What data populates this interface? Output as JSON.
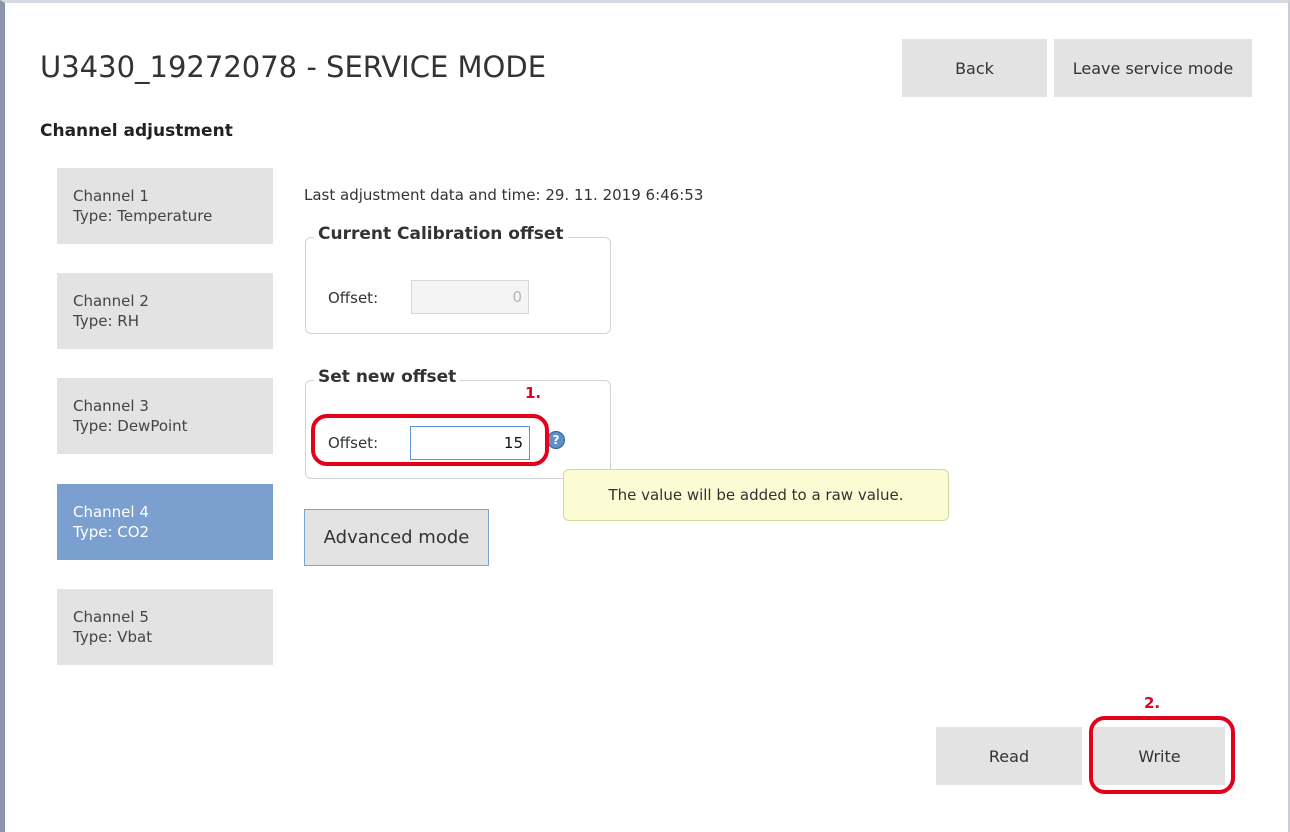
{
  "header": {
    "title": "U3430_19272078 - SERVICE MODE",
    "back_label": "Back",
    "leave_label": "Leave service mode"
  },
  "section_title": "Channel adjustment",
  "channels": [
    {
      "name": "Channel 1",
      "type": "Type: Temperature"
    },
    {
      "name": "Channel 2",
      "type": "Type: RH"
    },
    {
      "name": "Channel 3",
      "type": "Type: DewPoint"
    },
    {
      "name": "Channel 4",
      "type": "Type: CO2"
    },
    {
      "name": "Channel 5",
      "type": "Type: Vbat"
    }
  ],
  "selected_channel_index": 3,
  "last_adjustment": "Last adjustment data and time:  29. 11. 2019 6:46:53",
  "current_offset": {
    "legend": "Current Calibration offset",
    "label": "Offset:",
    "value": "0"
  },
  "new_offset": {
    "legend": "Set new offset",
    "label": "Offset:",
    "value": "15",
    "help_icon": "question-icon",
    "tooltip": "The value will be added to a raw value."
  },
  "advanced_label": "Advanced mode",
  "footer": {
    "read_label": "Read",
    "write_label": "Write"
  },
  "annotations": {
    "step1": "1.",
    "step2": "2.",
    "color": "#e3001b"
  },
  "colors": {
    "active_channel": "#7ba0cf",
    "button_bg": "#e3e3e3",
    "tooltip_bg": "#fbfbd4"
  }
}
